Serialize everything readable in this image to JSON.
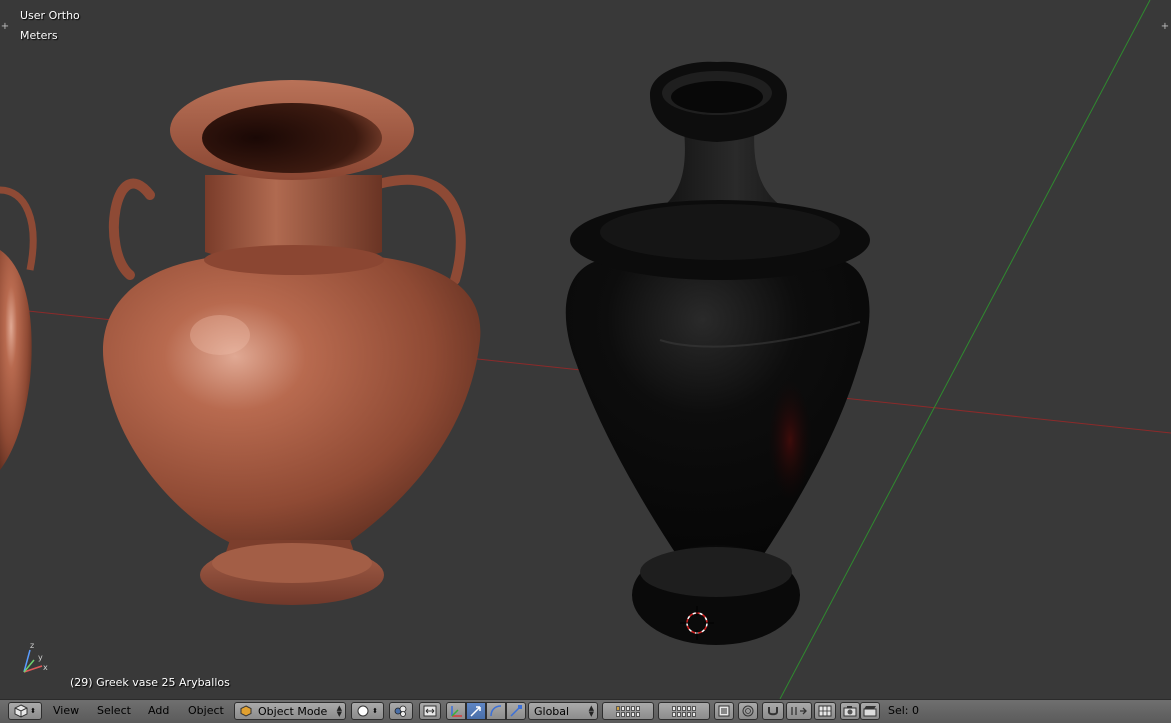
{
  "viewport": {
    "view_name": "User Ortho",
    "units": "Meters",
    "active_object": "(29) Greek vase 25 Aryballos"
  },
  "header": {
    "menus": [
      "View",
      "Select",
      "Add",
      "Object"
    ],
    "mode": "Object Mode",
    "orientation": "Global",
    "selection_info": "Sel: 0"
  },
  "icons": {
    "editor_type": "cube-icon",
    "shading": "sphere-icon",
    "pivot": "pivot-icon",
    "manipulator": "manipulator-icon",
    "snap": "magnet-icon",
    "render": "camera-icon"
  },
  "colors": {
    "viewport_bg": "#393939",
    "header_bg": "#5f5f5f",
    "x_axis": "#8c2a2a",
    "y_axis": "#2f8a2f",
    "active_blue": "#5680c2"
  }
}
